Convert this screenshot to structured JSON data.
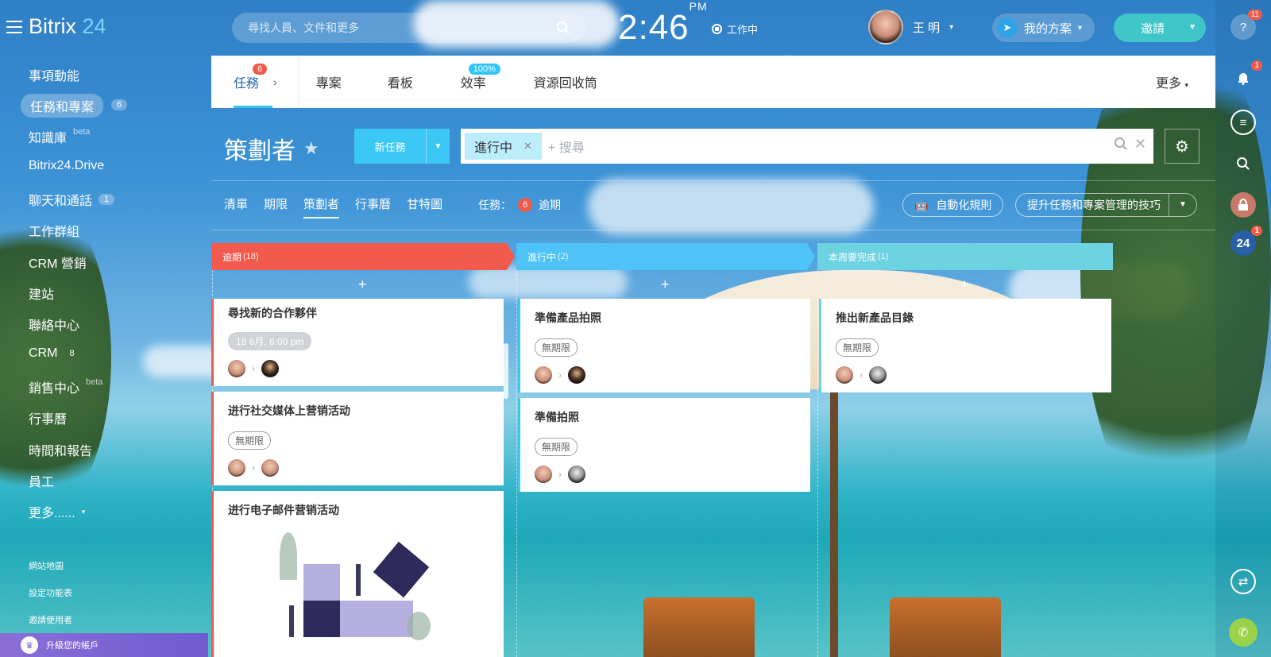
{
  "app": {
    "logo_main": "Bitrix",
    "logo_num": "24",
    "search_placeholder": "尋找人員、文件和更多",
    "clock": "2:46",
    "clock_ampm": "PM",
    "work_status": "工作中",
    "user_name": "王 明",
    "plan_label": "我的方案",
    "invite_label": "邀請"
  },
  "right_panel": {
    "help_badge": "11",
    "notif_badge": "1",
    "b24_label": "24",
    "b24_badge": "1"
  },
  "left_menu": {
    "items": [
      {
        "label": "事項動能"
      },
      {
        "label": "任務和專案",
        "count": "6"
      },
      {
        "label": "知識庫",
        "sup": "beta"
      },
      {
        "label": "Bitrix24.Drive"
      },
      {
        "label": "聊天和通話",
        "count": "1"
      },
      {
        "label": "工作群組"
      },
      {
        "label": "CRM 營銷"
      },
      {
        "label": "建站"
      },
      {
        "label": "聯絡中心"
      },
      {
        "label": "CRM",
        "count": "8"
      },
      {
        "label": "銷售中心",
        "sup": "beta"
      },
      {
        "label": "行事曆"
      },
      {
        "label": "時間和報告"
      },
      {
        "label": "員工"
      },
      {
        "label": "更多......"
      }
    ],
    "small_links": [
      "網站地圖",
      "設定功能表",
      "邀請使用者"
    ],
    "upgrade": "升級您的帳戶"
  },
  "tabs": {
    "items": [
      {
        "label": "任務",
        "badge": "6"
      },
      {
        "label": "專案"
      },
      {
        "label": "看板"
      },
      {
        "label": "效率",
        "badge": "100%"
      },
      {
        "label": "資源回收筒"
      }
    ],
    "more": "更多"
  },
  "page": {
    "title": "策劃者",
    "new_task": "新任務",
    "filter_chip": "進行中",
    "filter_placeholder": "+ 搜尋"
  },
  "view_tabs": [
    "清單",
    "期限",
    "策劃者",
    "行事曆",
    "甘特圖"
  ],
  "counter": {
    "label": "任務：",
    "count": "6",
    "suffix": "逾期"
  },
  "buttons": {
    "automation": "自動化規則",
    "tips": "提升任務和專案管理的技巧"
  },
  "columns": [
    {
      "title": "逾期",
      "count": "(18)",
      "color": "#f35a4e"
    },
    {
      "title": "進行中",
      "count": "(2)",
      "color": "#4fc3f7"
    },
    {
      "title": "本周要完成",
      "count": "(1)",
      "color": "#6dd3e0"
    }
  ],
  "cards": {
    "c1": {
      "title": "尋找新的合作夥伴",
      "deadline": "18 6月, 6:00 pm"
    },
    "c2": {
      "title": "进行社交媒体上营销活动",
      "deadline": "無期限"
    },
    "c3": {
      "title": "进行电子邮件营销活动"
    },
    "c4": {
      "title": "準備產品拍照",
      "deadline": "無期限"
    },
    "c5": {
      "title": "準備拍照",
      "deadline": "無期限"
    },
    "c6": {
      "title": "推出新產品目錄",
      "deadline": "無期限"
    }
  }
}
